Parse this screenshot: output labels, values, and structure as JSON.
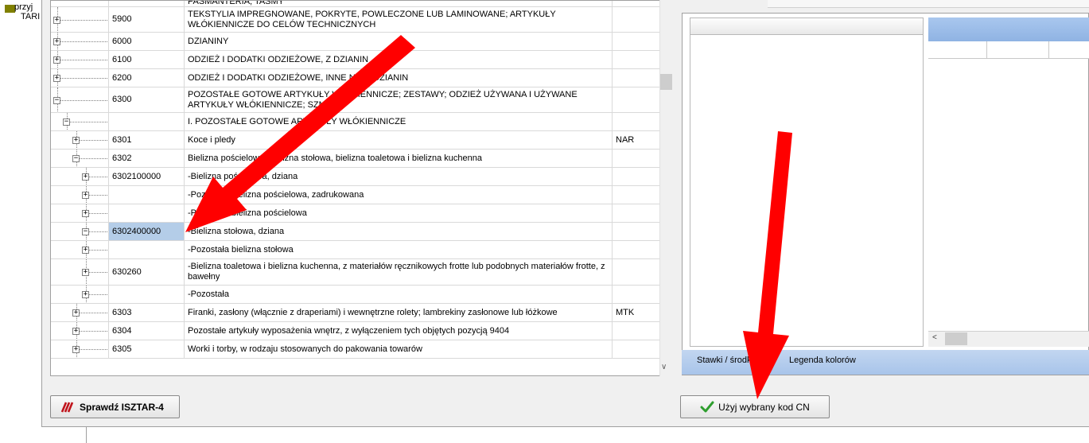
{
  "background": {
    "text_line1": "przyj",
    "text_line2": "TARI"
  },
  "top_partial_row": "PASMANTERIA; TAŚMY",
  "rows": [
    {
      "code": "5900",
      "desc": "TEKSTYLIA IMPREGNOWANE, POKRYTE, POWLECZONE LUB LAMINOWANE; ARTYKUŁY WŁÓKIENNICZE DO CELÓW TECHNICZNYCH",
      "unit": "",
      "box": "+"
    },
    {
      "code": "6000",
      "desc": "DZIANINY",
      "unit": "",
      "box": "+"
    },
    {
      "code": "6100",
      "desc": "ODZIEŻ I DODATKI ODZIEŻOWE, Z DZIANIN",
      "unit": "",
      "box": "+"
    },
    {
      "code": "6200",
      "desc": "ODZIEŻ I DODATKI ODZIEŻOWE, INNE NIŻ Z DZIANIN",
      "unit": "",
      "box": "+"
    },
    {
      "code": "6300",
      "desc": "POZOSTAŁE GOTOWE ARTYKUŁY WŁÓKIENNICZE; ZESTAWY; ODZIEŻ UŻYWANA I UŻYWANE ARTYKUŁY WŁÓKIENNICZE; SZMATY",
      "unit": "",
      "box": "−"
    },
    {
      "code": "",
      "desc": "I. POZOSTAŁE GOTOWE ARTYKUŁY WŁÓKIENNICZE",
      "unit": "",
      "box": "−"
    },
    {
      "code": "6301",
      "desc": "Koce i pledy",
      "unit": "NAR",
      "box": "+"
    },
    {
      "code": "6302",
      "desc": "Bielizna pościelowa, bielizna stołowa, bielizna toaletowa i bielizna kuchenna",
      "unit": "",
      "box": "−"
    },
    {
      "code": "6302100000",
      "desc": "-Bielizna pościelowa, dziana",
      "unit": "",
      "box": "+"
    },
    {
      "code": "",
      "desc": "-Pozostała bielizna pościelowa, zadrukowana",
      "unit": "",
      "box": "+"
    },
    {
      "code": "",
      "desc": "-Pozostała bielizna pościelowa",
      "unit": "",
      "box": "+"
    },
    {
      "code": "6302400000",
      "desc": "-Bielizna stołowa, dziana",
      "unit": "",
      "box": "−",
      "selected": true
    },
    {
      "code": "",
      "desc": "-Pozostała bielizna stołowa",
      "unit": "",
      "box": "+"
    },
    {
      "code": "630260",
      "desc": "-Bielizna toaletowa i bielizna kuchenna, z materiałów ręcznikowych frotte lub podobnych materiałów frotte, z bawełny",
      "unit": "",
      "box": "+"
    },
    {
      "code": "",
      "desc": "-Pozostała",
      "unit": "",
      "box": "+"
    },
    {
      "code": "6303",
      "desc": "Firanki, zasłony (włącznie z draperiami) i wewnętrzne rolety; lambrekiny zasłonowe lub łóżkowe",
      "unit": "MTK",
      "box": "+"
    },
    {
      "code": "6304",
      "desc": "Pozostałe artykuły wyposażenia wnętrz, z wyłączeniem tych objętych pozycją 9404",
      "unit": "",
      "box": "+"
    },
    {
      "code": "6305",
      "desc": "Worki i torby, w rodzaju stosowanych do pakowania towarów",
      "unit": "",
      "box": "+"
    }
  ],
  "right_panel": {
    "tab_rates": "Stawki / środki",
    "tab_legend": "Legenda kolorów",
    "scroll_left": "<"
  },
  "scroll": {
    "down": "∨"
  },
  "buttons": {
    "check": "Sprawdź ISZTAR-4",
    "use_code": "Użyj wybrany kod CN"
  },
  "colors": {
    "selected_cell": "#b4cde8",
    "panel_blue": "#a8c4ea",
    "arrow_red": "#ff0000",
    "check_icon": "#2e9e2e",
    "isztar_icon": "#c0141c"
  }
}
